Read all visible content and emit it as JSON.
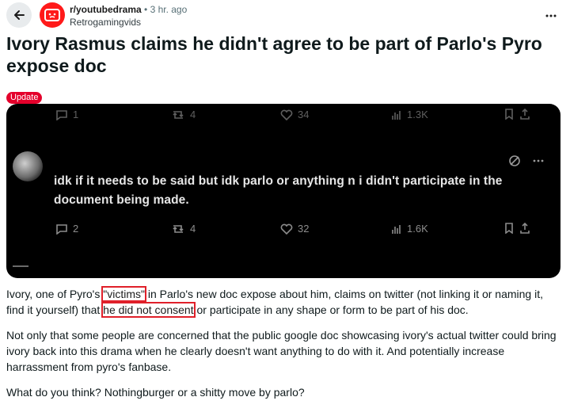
{
  "header": {
    "subreddit": "r/youtubedrama",
    "separator": "•",
    "time": "3 hr. ago",
    "username": "Retrogamingvids"
  },
  "post": {
    "title": "Ivory Rasmus claims he didn't agree to be part of Parlo's Pyro expose doc",
    "flair": "Update"
  },
  "media": {
    "top_actions": {
      "replies": "1",
      "reposts": "4",
      "likes": "34",
      "views": "1.3K"
    },
    "tweet_text": "idk if it needs to be said but idk parlo or anything n i didn't participate in the document being made.",
    "bottom_actions": {
      "replies": "2",
      "reposts": "4",
      "likes": "32",
      "views": "1.6K"
    }
  },
  "body": {
    "p1_a": "Ivory, one of Pyro's ",
    "p1_hl1": "\"victims\"",
    "p1_b": " in Parlo's new doc expose about him, claims on twitter (not linking it or naming it, find it yourself) that ",
    "p1_hl2": "he did not consent",
    "p1_c": " or participate in any shape or form to be part of his doc.",
    "p2": "Not only that some people are concerned that the public google doc showcasing ivory's actual twitter could bring ivory back into this drama when he clearly doesn't want anything to do with it. And potentially increase harrassment from pyro's fanbase.",
    "p3": "What do you think? Nothingburger or a shitty move by parlo?"
  },
  "colors": {
    "accent": "#e4002b",
    "highlight_box": "#e0202a",
    "subreddit_icon": "#ff1a1a"
  }
}
